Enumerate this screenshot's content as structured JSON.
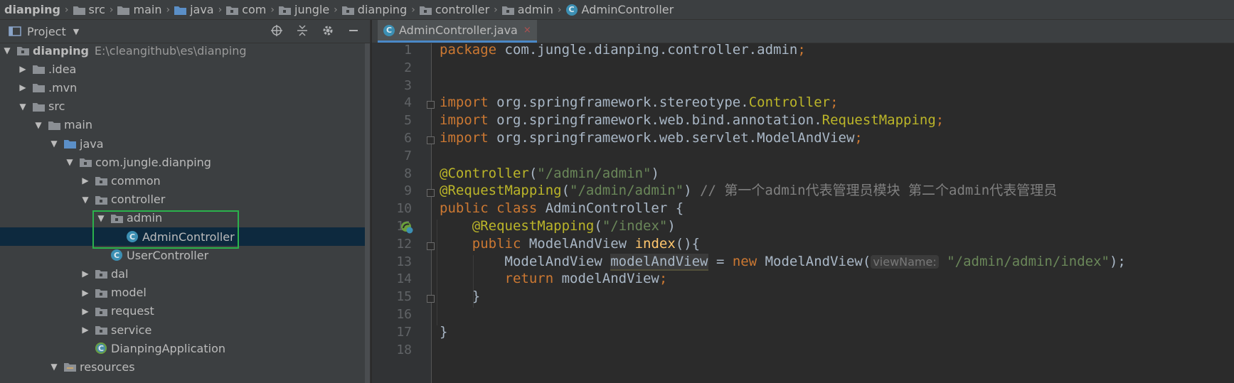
{
  "breadcrumb": [
    {
      "label": "dianping",
      "icon": "module-folder-icon"
    },
    {
      "label": "src",
      "icon": "folder-icon"
    },
    {
      "label": "main",
      "icon": "folder-icon"
    },
    {
      "label": "java",
      "icon": "source-folder-icon"
    },
    {
      "label": "com",
      "icon": "package-folder-icon"
    },
    {
      "label": "jungle",
      "icon": "package-folder-icon"
    },
    {
      "label": "dianping",
      "icon": "package-folder-icon"
    },
    {
      "label": "controller",
      "icon": "package-folder-icon"
    },
    {
      "label": "admin",
      "icon": "package-folder-icon"
    },
    {
      "label": "AdminController",
      "icon": "class-icon"
    }
  ],
  "project": {
    "title": "Project",
    "tree": [
      {
        "label": "dianping",
        "path": "E:\\cleangithub\\es\\dianping",
        "depth": 0,
        "expanded": true,
        "type": "module",
        "bold": true
      },
      {
        "label": ".idea",
        "depth": 1,
        "expanded": false,
        "type": "folder"
      },
      {
        "label": ".mvn",
        "depth": 1,
        "expanded": false,
        "type": "folder"
      },
      {
        "label": "src",
        "depth": 1,
        "expanded": true,
        "type": "folder"
      },
      {
        "label": "main",
        "depth": 2,
        "expanded": true,
        "type": "folder"
      },
      {
        "label": "java",
        "depth": 3,
        "expanded": true,
        "type": "source"
      },
      {
        "label": "com.jungle.dianping",
        "depth": 4,
        "expanded": true,
        "type": "package"
      },
      {
        "label": "common",
        "depth": 5,
        "expanded": false,
        "type": "package"
      },
      {
        "label": "controller",
        "depth": 5,
        "expanded": true,
        "type": "package"
      },
      {
        "label": "admin",
        "depth": 6,
        "expanded": true,
        "type": "package"
      },
      {
        "label": "AdminController",
        "depth": 7,
        "type": "class",
        "selected": true
      },
      {
        "label": "UserController",
        "depth": 6,
        "type": "class"
      },
      {
        "label": "dal",
        "depth": 5,
        "expanded": false,
        "type": "package"
      },
      {
        "label": "model",
        "depth": 5,
        "expanded": false,
        "type": "package"
      },
      {
        "label": "request",
        "depth": 5,
        "expanded": false,
        "type": "package"
      },
      {
        "label": "service",
        "depth": 5,
        "expanded": false,
        "type": "package"
      },
      {
        "label": "DianpingApplication",
        "depth": 5,
        "type": "app-class"
      },
      {
        "label": "resources",
        "depth": 3,
        "expanded": true,
        "type": "resources"
      }
    ]
  },
  "editor": {
    "tab_label": "AdminController.java",
    "close_glyph": "×",
    "lines": [
      {
        "n": "1",
        "tokens": [
          {
            "t": "package ",
            "c": "kw"
          },
          {
            "t": "com.jungle.dianping.controller.admin",
            "c": ""
          },
          {
            "t": ";",
            "c": "kw"
          }
        ]
      },
      {
        "n": "2",
        "tokens": []
      },
      {
        "n": "3",
        "tokens": []
      },
      {
        "n": "4",
        "tokens": [
          {
            "t": "import ",
            "c": "kw"
          },
          {
            "t": "org.springframework.stereotype.",
            "c": ""
          },
          {
            "t": "Controller",
            "c": "ty"
          },
          {
            "t": ";",
            "c": "kw"
          }
        ]
      },
      {
        "n": "5",
        "tokens": [
          {
            "t": "import ",
            "c": "kw"
          },
          {
            "t": "org.springframework.web.bind.annotation.",
            "c": ""
          },
          {
            "t": "RequestMapping",
            "c": "ty"
          },
          {
            "t": ";",
            "c": "kw"
          }
        ]
      },
      {
        "n": "6",
        "tokens": [
          {
            "t": "import ",
            "c": "kw"
          },
          {
            "t": "org.springframework.web.servlet.ModelAndView",
            "c": ""
          },
          {
            "t": ";",
            "c": "kw"
          }
        ]
      },
      {
        "n": "7",
        "tokens": []
      },
      {
        "n": "8",
        "tokens": [
          {
            "t": "@Controller",
            "c": "ann"
          },
          {
            "t": "(",
            "c": ""
          },
          {
            "t": "\"/admin/admin\"",
            "c": "str"
          },
          {
            "t": ")",
            "c": ""
          }
        ]
      },
      {
        "n": "9",
        "tokens": [
          {
            "t": "@RequestMapping",
            "c": "ann"
          },
          {
            "t": "(",
            "c": ""
          },
          {
            "t": "\"/admin/admin\"",
            "c": "str"
          },
          {
            "t": ") ",
            "c": ""
          },
          {
            "t": "// 第一个admin代表管理员模块 第二个admin代表管理员",
            "c": "cmt"
          }
        ]
      },
      {
        "n": "10",
        "tokens": [
          {
            "t": "public class ",
            "c": "kw"
          },
          {
            "t": "AdminController {",
            "c": ""
          }
        ]
      },
      {
        "n": "11",
        "tokens": [
          {
            "t": "    ",
            "c": ""
          },
          {
            "t": "@RequestMapping",
            "c": "ann"
          },
          {
            "t": "(",
            "c": ""
          },
          {
            "t": "\"/index\"",
            "c": "str"
          },
          {
            "t": ")",
            "c": ""
          }
        ]
      },
      {
        "n": "12",
        "tokens": [
          {
            "t": "    ",
            "c": ""
          },
          {
            "t": "public ",
            "c": "kw"
          },
          {
            "t": "ModelAndView ",
            "c": ""
          },
          {
            "t": "index",
            "c": "fn"
          },
          {
            "t": "(){",
            "c": ""
          }
        ]
      },
      {
        "n": "13",
        "tokens": [
          {
            "t": "        ModelAndView ",
            "c": ""
          },
          {
            "t": "modelAndView",
            "c": "var"
          },
          {
            "t": " = ",
            "c": ""
          },
          {
            "t": "new ",
            "c": "kw"
          },
          {
            "t": "ModelAndView(",
            "c": ""
          },
          {
            "t": "viewName:",
            "c": "hint"
          },
          {
            "t": " ",
            "c": ""
          },
          {
            "t": "\"/admin/admin/index\"",
            "c": "str"
          },
          {
            "t": ");",
            "c": ""
          }
        ]
      },
      {
        "n": "14",
        "tokens": [
          {
            "t": "        ",
            "c": ""
          },
          {
            "t": "return ",
            "c": "kw"
          },
          {
            "t": "modelAndView",
            "c": ""
          },
          {
            "t": ";",
            "c": "kw"
          }
        ]
      },
      {
        "n": "15",
        "tokens": [
          {
            "t": "    }",
            "c": ""
          }
        ]
      },
      {
        "n": "16",
        "tokens": []
      },
      {
        "n": "17",
        "tokens": [
          {
            "t": "}",
            "c": ""
          }
        ]
      },
      {
        "n": "18",
        "tokens": []
      }
    ]
  },
  "colors": {
    "selection_box": "#2bb24c",
    "keyword": "#cc7832",
    "annotation": "#bbb529",
    "string": "#6a8759",
    "comment": "#808080"
  }
}
